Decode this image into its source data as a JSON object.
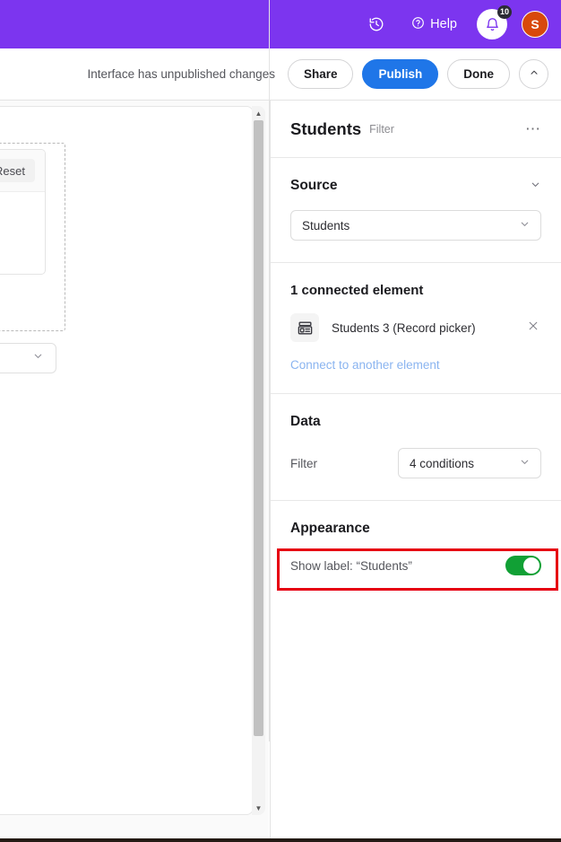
{
  "topbar": {
    "history_icon": "history-clock-icon",
    "help_label": "Help",
    "help_icon": "question-circle-icon",
    "bell_icon": "notification-bell-icon",
    "notification_count": "10",
    "avatar_initial": "S",
    "background_color": "#7c35ef",
    "avatar_color": "#d8490c"
  },
  "toolbar": {
    "status_text": "Interface has unpublished changes",
    "share_label": "Share",
    "publish_label": "Publish",
    "done_label": "Done",
    "collapse_icon": "chevron-up-icon",
    "publish_color": "#1f76e8"
  },
  "canvas": {
    "reset_label": "Reset",
    "select_chevron_icon": "chevron-down-icon",
    "scrollbar": {
      "up_icon": "scroll-up-arrow-icon",
      "down_icon": "scroll-down-arrow-icon"
    }
  },
  "panel": {
    "title": "Students",
    "subtitle": "Filter",
    "more_icon": "ellipsis-icon",
    "source": {
      "section_title": "Source",
      "collapse_icon": "chevron-down-icon",
      "selected_value": "Students",
      "dropdown_icon": "chevron-down-icon"
    },
    "connected": {
      "heading": "1 connected element",
      "element_icon": "record-picker-icon",
      "element_label": "Students 3 (Record picker)",
      "remove_icon": "close-x-icon",
      "connect_link": "Connect to another element"
    },
    "data": {
      "section_title": "Data",
      "filter_label": "Filter",
      "filter_value": "4 conditions",
      "dropdown_icon": "chevron-down-icon",
      "highlight_color": "#e60012"
    },
    "appearance": {
      "section_title": "Appearance",
      "show_label_text": "Show label: “Students”",
      "toggle_state": "on",
      "toggle_color": "#11a035"
    }
  }
}
